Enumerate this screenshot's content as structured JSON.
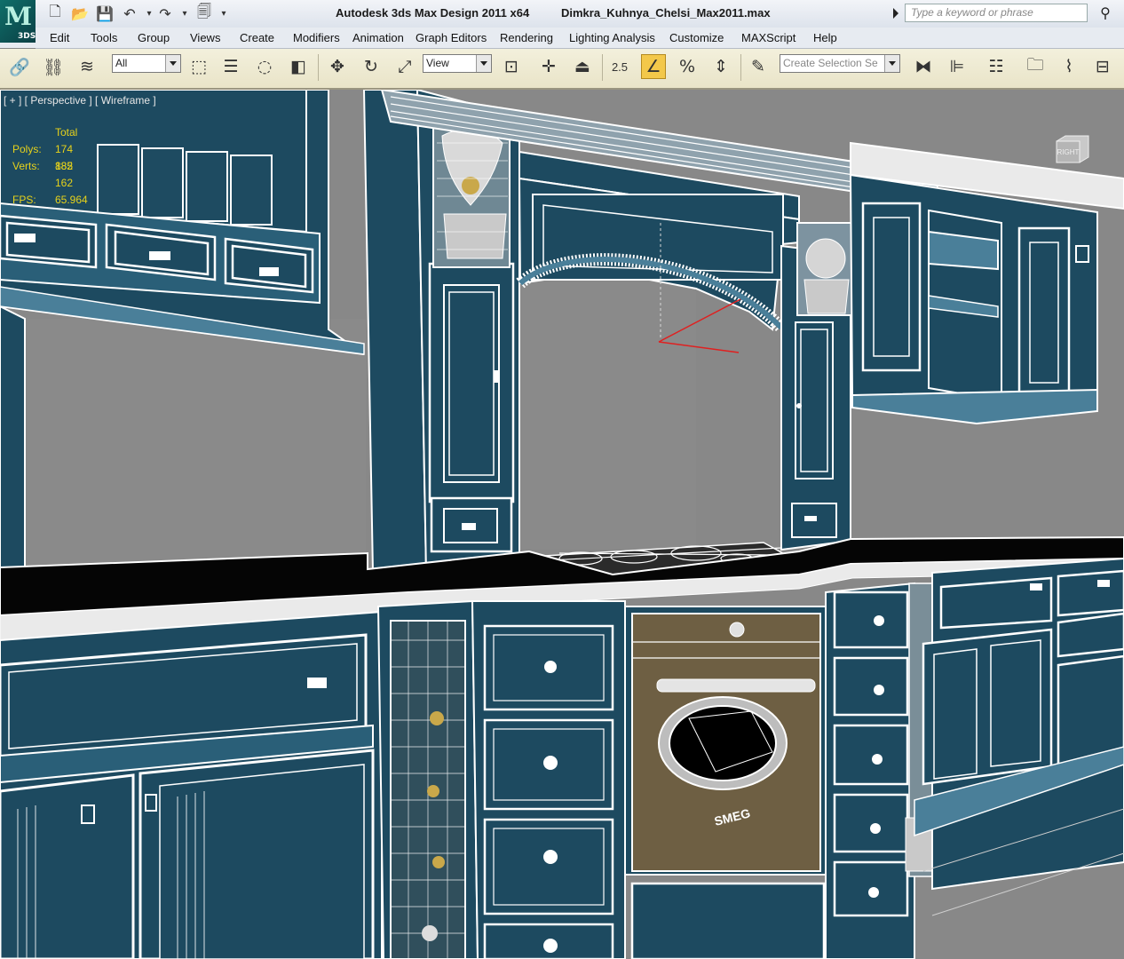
{
  "app": {
    "title": "Autodesk 3ds Max Design 2011 x64",
    "file": "Dimkra_Kuhnya_Chelsi_Max2011.max",
    "logo_label": "3DS",
    "logo_letter": "M",
    "search_placeholder": "Type a keyword or phrase"
  },
  "menu": [
    "Edit",
    "Tools",
    "Group",
    "Views",
    "Create",
    "Modifiers",
    "Animation",
    "Graph Editors",
    "Rendering",
    "Lighting Analysis",
    "Customize",
    "MAXScript",
    "Help"
  ],
  "toolbar": {
    "selection_filter": "All",
    "reference_coord": "View",
    "named_selection": "Create Selection Se",
    "snap_value": "2.5"
  },
  "viewport": {
    "label": "[ + ] [ Perspective ] [ Wireframe ]",
    "stats_header": "Total",
    "stats": [
      {
        "key": "Polys:",
        "value": "174 882"
      },
      {
        "key": "Verts:",
        "value": "185 162"
      }
    ],
    "fps_key": "FPS:",
    "fps_value": "65.964",
    "viewcube_label": "RIGHT",
    "oven_brand": "SMEG"
  },
  "colors": {
    "cabinet": "#1d4a60",
    "wireframe": "#ffffff",
    "background": "#888888",
    "stats_text": "#e7d21a",
    "toolbar_bg": "#efeacf",
    "oven": "#6e5f43"
  }
}
